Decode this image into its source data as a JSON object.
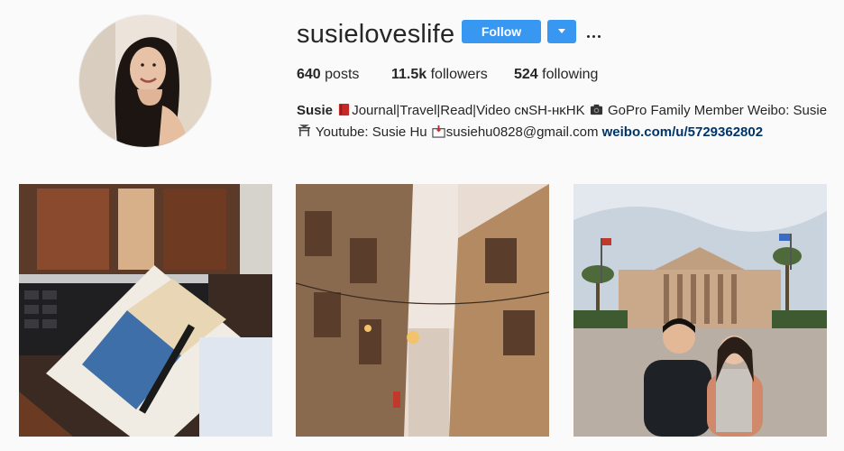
{
  "profile": {
    "username": "susieloveslife",
    "follow_label": "Follow",
    "stats": {
      "posts_count": "640",
      "posts_label": "posts",
      "followers_count": "11.5k",
      "followers_label": "followers",
      "following_count": "524",
      "following_label": "following"
    },
    "bio": {
      "name": "Susie",
      "part1": "Journal|Travel|Read|Video",
      "region": "ᴄɴSH-ʜᴋHK",
      "part2": "GoPro Family Member Weibo: Susie",
      "part3": "Youtube: Susie Hu",
      "email": "susiehu0828@gmail.com",
      "link": "weibo.com/u/5729362802"
    }
  },
  "posts": [
    {
      "subject": "journal-desk"
    },
    {
      "subject": "street-valletta"
    },
    {
      "subject": "couple-theatre"
    }
  ],
  "colors": {
    "accent": "#3897f0",
    "text": "#262626",
    "link": "#003569",
    "background": "#fafafa"
  }
}
